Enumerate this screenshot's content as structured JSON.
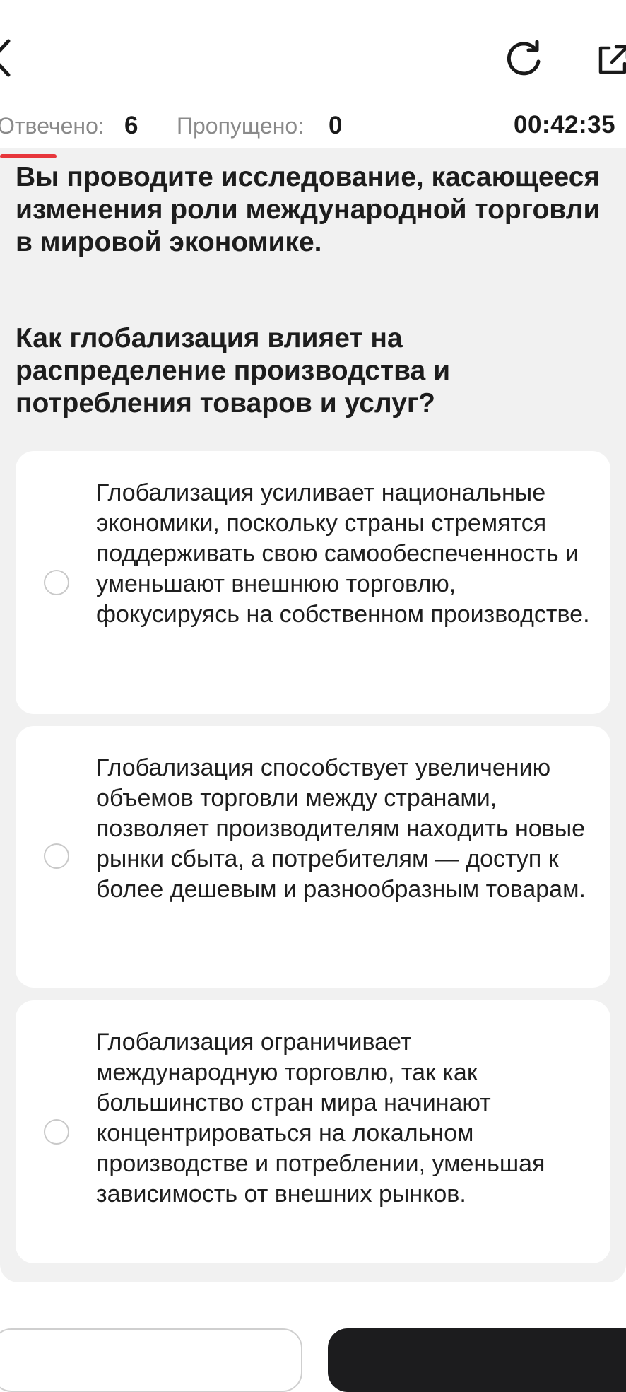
{
  "header": {
    "back_icon": "chevron-left-icon",
    "reload_icon": "reload-icon",
    "external_icon": "external-link-icon"
  },
  "stats": {
    "answered_label": "Отвечено:",
    "answered_value": "6",
    "skipped_label": "Пропущено:",
    "skipped_value": "0",
    "timer": "00:42:35"
  },
  "progress": {
    "fraction": 0.09,
    "color": "#e7363b"
  },
  "question": {
    "context": "Вы проводите исследование, касающееся изменения роли международной торговли в мировой экономике.",
    "prompt": "Как глобализация влияет на распределение производства и потребления товаров и услуг?"
  },
  "options": [
    {
      "text": "Глобализация усиливает национальные экономики, поскольку страны стремятся поддерживать свою самообеспеченность и уменьшают внешнюю торговлю, фокусируясь на собственном производстве.",
      "selected": false
    },
    {
      "text": "Глобализация способствует увеличению объемов торговли между странами, позволяет производителям находить новые рынки сбыта, а потребителям — доступ к более дешевым и разнообразным товарам.",
      "selected": false
    },
    {
      "text": "Глобализация ограничивает международную торговлю, так как большинство стран мира начинают концентрироваться на локальном производстве и потреблении, уменьшая зависимость от внешних рынков.",
      "selected": false
    }
  ],
  "colors": {
    "accent": "#e7363b",
    "background": "#f1f1f1",
    "card": "#ffffff",
    "primary_button": "#1c1c1e"
  }
}
